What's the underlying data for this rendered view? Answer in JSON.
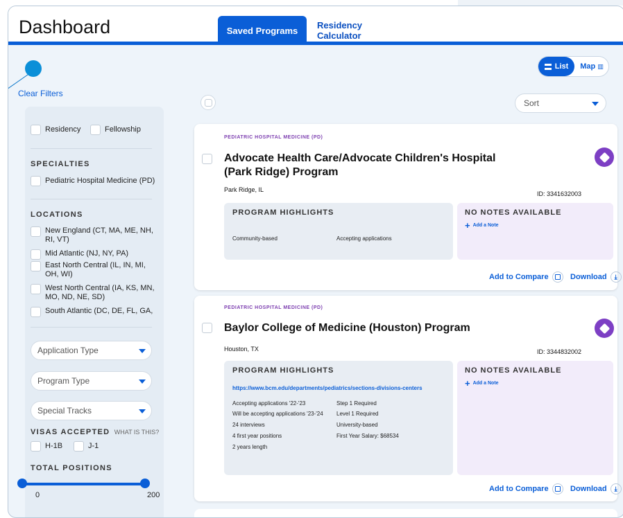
{
  "header": {
    "title": "Dashboard",
    "tabs": [
      {
        "label": "Saved Programs",
        "active": true
      },
      {
        "label": "Residency Calculator",
        "active": false
      }
    ]
  },
  "colors": {
    "accent": "#0a5ed7",
    "specialty": "#7d3fb0",
    "badge": "#7d3fc4",
    "notes_bg": "#f2ecfa"
  },
  "filters": {
    "clear_label": "Clear Filters",
    "program_kind": [
      "Residency",
      "Fellowship"
    ],
    "specialties_heading": "SPECIALTIES",
    "specialties": [
      "Pediatric Hospital Medicine (PD)"
    ],
    "locations_heading": "LOCATIONS",
    "locations": [
      "New England (CT, MA, ME, NH, RI, VT)",
      "Mid Atlantic (NJ, NY, PA)",
      "East North Central (IL, IN, MI, OH, WI)",
      "West North Central (IA, KS, MN, MO, ND, NE, SD)",
      "South Atlantic (DC, DE, FL, GA,"
    ],
    "selects": [
      "Application Type",
      "Program Type",
      "Special Tracks"
    ],
    "visas_heading": "VISAS ACCEPTED",
    "visas_help": "WHAT IS THIS?",
    "visas": [
      "H-1B",
      "J-1"
    ],
    "positions_heading": "TOTAL POSITIONS",
    "positions_min": "0",
    "positions_max": "200"
  },
  "view_toggle": {
    "list_label": "List",
    "map_label": "Map"
  },
  "sort_placeholder": "Sort",
  "programs": [
    {
      "specialty": "PEDIATRIC HOSPITAL MEDICINE (PD)",
      "name": "Advocate Health Care/Advocate Children's Hospital (Park Ridge) Program",
      "location": "Park Ridge, IL",
      "id": "ID: 3341632003",
      "highlights_heading": "PROGRAM HIGHLIGHTS",
      "url": "",
      "highlights_left": [
        "Community-based"
      ],
      "highlights_right": [
        "Accepting applications"
      ],
      "notes_heading": "NO NOTES AVAILABLE",
      "add_note": "Add a Note",
      "compare": "Add to Compare",
      "download": "Download"
    },
    {
      "specialty": "PEDIATRIC HOSPITAL MEDICINE (PD)",
      "name": "Baylor College of Medicine (Houston) Program",
      "location": "Houston, TX",
      "id": "ID: 3344832002",
      "highlights_heading": "PROGRAM HIGHLIGHTS",
      "url": "https://www.bcm.edu/departments/pediatrics/sections-divisions-centers",
      "highlights_left": [
        "Accepting applications '22-'23",
        "Will be accepting applications '23-'24",
        "24 interviews",
        "4 first year positions",
        "2 years length"
      ],
      "highlights_right": [
        "Step 1 Required",
        "Level 1 Required",
        "University-based",
        "First Year Salary: $68534"
      ],
      "notes_heading": "NO NOTES AVAILABLE",
      "add_note": "Add a Note",
      "compare": "Add to Compare",
      "download": "Download"
    }
  ]
}
